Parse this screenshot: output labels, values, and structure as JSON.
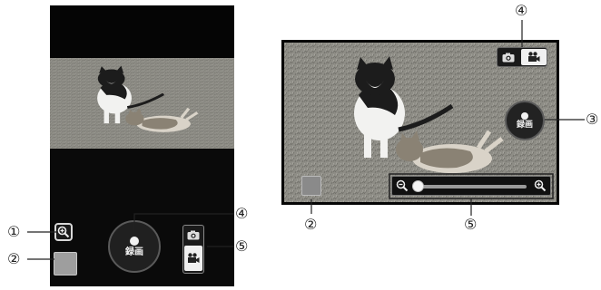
{
  "portrait": {
    "record_label": "録画",
    "icons": {
      "zoom": "zoom-in-icon",
      "camera": "camera-icon",
      "video": "video-camera-icon"
    }
  },
  "landscape": {
    "record_label": "録画",
    "zoom_level": 0.0,
    "icons": {
      "zoom_out": "zoom-out-icon",
      "zoom_in": "zoom-in-icon",
      "camera": "camera-icon",
      "video": "video-camera-icon"
    }
  },
  "callouts": {
    "n1": "①",
    "n2": "②",
    "n3": "③",
    "n4": "④",
    "n5": "⑤"
  },
  "colors": {
    "background": "#ffffff",
    "screen": "#050505",
    "accent_white": "#f0f0f0"
  }
}
